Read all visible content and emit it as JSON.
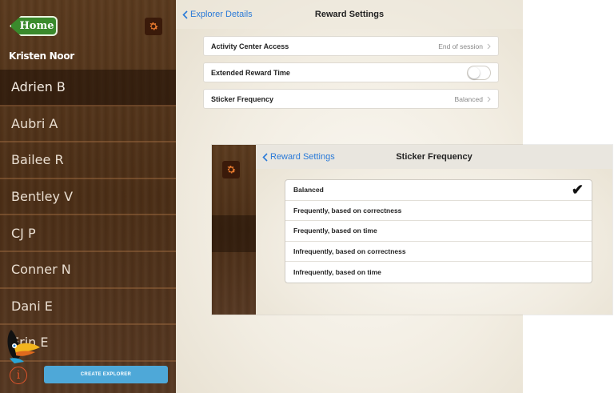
{
  "sidebar": {
    "home_label": "Home",
    "user_name": "Kristen Noor",
    "explorers": [
      {
        "name": "Adrien B",
        "selected": true
      },
      {
        "name": "Aubri A",
        "selected": false
      },
      {
        "name": "Bailee R",
        "selected": false
      },
      {
        "name": "Bentley V",
        "selected": false
      },
      {
        "name": "CJ P",
        "selected": false
      },
      {
        "name": "Conner N",
        "selected": false
      },
      {
        "name": "Dani E",
        "selected": false
      },
      {
        "name": "Erin E",
        "selected": false
      }
    ],
    "info_label": "i",
    "create_label": "CREATE EXPLORER"
  },
  "reward_settings": {
    "back_label": "Explorer Details",
    "title": "Reward Settings",
    "rows": [
      {
        "label": "Activity Center Access",
        "value": "End of session"
      },
      {
        "label": "Extended Reward Time",
        "toggle": false
      },
      {
        "label": "Sticker Frequency",
        "value": "Balanced"
      }
    ]
  },
  "sticker_frequency": {
    "back_label": "Reward Settings",
    "title": "Sticker Frequency",
    "selected": "Balanced",
    "options": [
      "Balanced",
      "Frequently, based on correctness",
      "Frequently, based on time",
      "Infrequently, based on correctness",
      "Infrequently, based on time"
    ]
  },
  "colors": {
    "accent": "#2a7ad8",
    "home_green": "#3a8a2c",
    "create_blue": "#4ea8d8",
    "info_orange": "#e0552c",
    "wood": "#4b2e16"
  }
}
